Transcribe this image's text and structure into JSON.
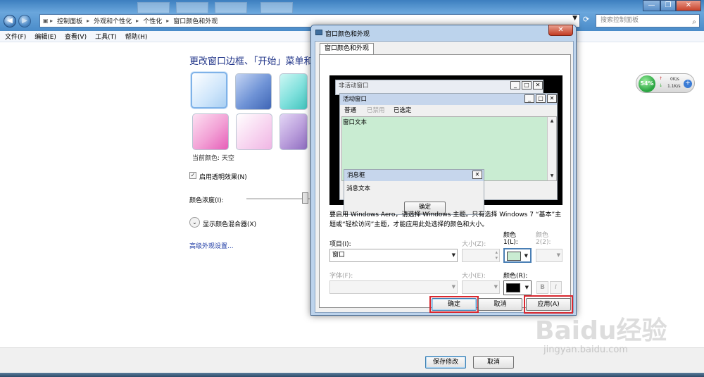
{
  "explorer": {
    "breadcrumb": [
      "控制面板",
      "外观和个性化",
      "个性化",
      "窗口颜色和外观"
    ],
    "search_placeholder": "搜索控制面板",
    "window_controls": [
      "—",
      "❐",
      "✕"
    ]
  },
  "menubar": [
    "文件(F)",
    "编辑(E)",
    "查看(V)",
    "工具(T)",
    "帮助(H)"
  ],
  "main": {
    "title": "更改窗口边框、「开始」菜单和",
    "current_color_label": "当前颜色: 天空",
    "transparency_label": "启用透明效果(N)",
    "intensity_label": "颜色浓度(I):",
    "mixer_label": "显示颜色混合器(X)",
    "advanced_link": "高级外观设置...",
    "swatch_colors": [
      "#cfe6fb",
      "#6f93d6",
      "#7fe0dc",
      "#f2a0d5",
      "#f7d2ef",
      "#b99ddb"
    ],
    "intensity_percent": 97
  },
  "footer": {
    "save": "保存修改",
    "cancel": "取消"
  },
  "widget": {
    "percent": "54%",
    "up": "0K/s",
    "down": "1.1K/s",
    "plus": "+"
  },
  "dialog": {
    "title": "窗口颜色和外观",
    "close": "✕",
    "tab": "窗口颜色和外观",
    "preview": {
      "inactive_title": "非活动窗口",
      "active_title": "活动窗口",
      "menu": [
        "普通",
        "已禁用",
        "已选定"
      ],
      "window_text": "窗口文本",
      "msg_title": "消息框",
      "msg_text": "消息文本",
      "msg_ok": "确定",
      "title_buttons": [
        "_",
        "□",
        "✕"
      ],
      "window_color": "#c9ecd2"
    },
    "description": "要启用 Windows Aero，请选择 Windows 主题。只有选择 Windows 7 “基本”主题或“轻松访问”主题，才能应用此处选择的颜色和大小。",
    "item_label": "项目(I):",
    "item_value": "窗口",
    "size_z_label": "大小(Z):",
    "color1_label_a": "颜色",
    "color1_label_b": "1(L):",
    "color2_label_a": "颜色",
    "color2_label_b": "2(2):",
    "font_label": "字体(F):",
    "size_e_label": "大小(E):",
    "color_r_label": "颜色(R):",
    "color1_value": "#c9ecd2",
    "color_r_value": "#000000",
    "bold": "B",
    "italic": "I",
    "ok": "确定",
    "cancel": "取消",
    "apply": "应用(A)"
  },
  "watermark": {
    "brand": "Baidu经验",
    "url": "jingyan.baidu.com"
  }
}
